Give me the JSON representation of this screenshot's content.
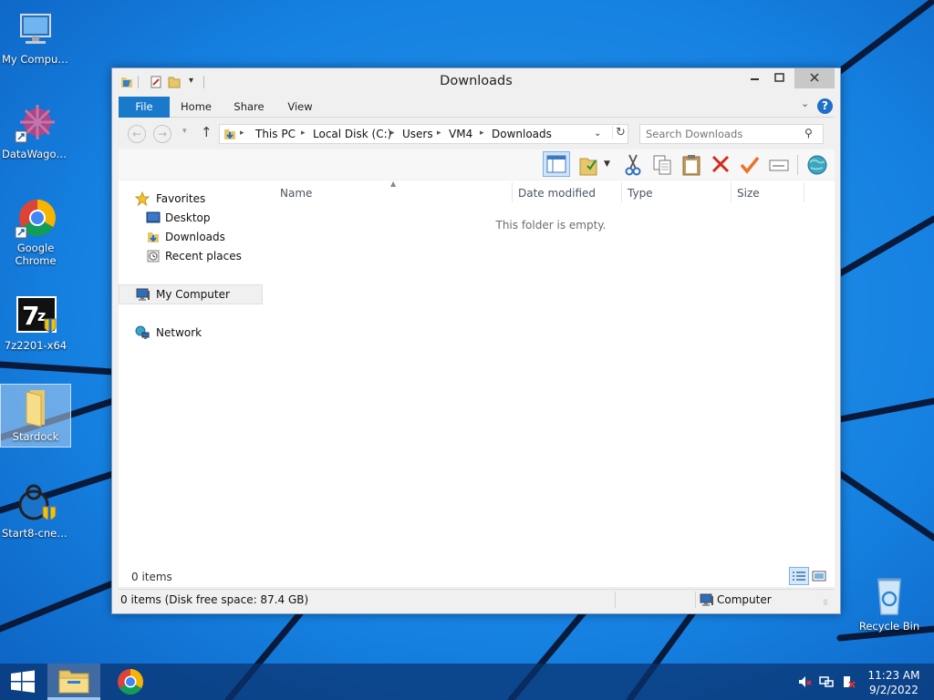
{
  "desktop": {
    "icons": [
      {
        "label": "My Computer"
      },
      {
        "label": "DataWagon..."
      },
      {
        "label": "Google Chrome"
      },
      {
        "label": "7z2201-x64"
      },
      {
        "label": "Stardock"
      },
      {
        "label": "Start8-cnet-..."
      },
      {
        "label": "Recycle Bin"
      }
    ]
  },
  "window": {
    "title": "Downloads",
    "ribbon_tabs": {
      "file": "File",
      "home": "Home",
      "share": "Share",
      "view": "View"
    },
    "help_label": "?",
    "breadcrumbs": [
      "This PC",
      "Local Disk (C:)",
      "Users",
      "VM4",
      "Downloads"
    ],
    "search_placeholder": "Search Downloads",
    "nav": {
      "favorites": "Favorites",
      "desktop": "Desktop",
      "downloads": "Downloads",
      "recent_places": "Recent places",
      "my_computer": "My Computer",
      "network": "Network"
    },
    "columns": {
      "name": "Name",
      "date_modified": "Date modified",
      "type": "Type",
      "size": "Size"
    },
    "empty_message": "This folder is empty.",
    "items_count": "0 items",
    "status_left": "0 items (Disk free space: 87.4 GB)",
    "status_right": "Computer"
  },
  "taskbar": {
    "time": "11:23 AM",
    "date": "9/2/2022"
  },
  "colors": {
    "accent": "#1979ca",
    "desktop_bg": "#1077d6",
    "selection": "#cfe4f8"
  }
}
